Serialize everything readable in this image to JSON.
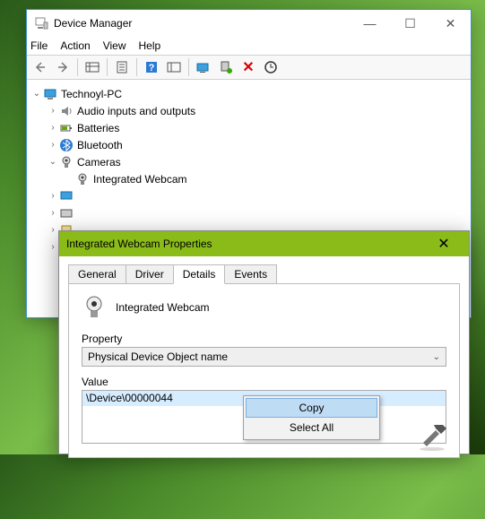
{
  "device_manager": {
    "title": "Device Manager",
    "title_buttons": {
      "minimize": "—",
      "maximize": "☐",
      "close": "✕"
    },
    "menu": {
      "file": "File",
      "action": "Action",
      "view": "View",
      "help": "Help"
    },
    "tree": {
      "root": "Technoyl-PC",
      "audio": "Audio inputs and outputs",
      "batteries": "Batteries",
      "bluetooth": "Bluetooth",
      "cameras": "Cameras",
      "integrated_webcam": "Integrated Webcam"
    }
  },
  "properties": {
    "title": "Integrated Webcam Properties",
    "close": "✕",
    "tabs": {
      "general": "General",
      "driver": "Driver",
      "details": "Details",
      "events": "Events"
    },
    "device_name": "Integrated Webcam",
    "property_label": "Property",
    "property_value": "Physical Device Object name",
    "value_label": "Value",
    "value": "\\Device\\00000044"
  },
  "context_menu": {
    "copy": "Copy",
    "select_all": "Select All"
  }
}
